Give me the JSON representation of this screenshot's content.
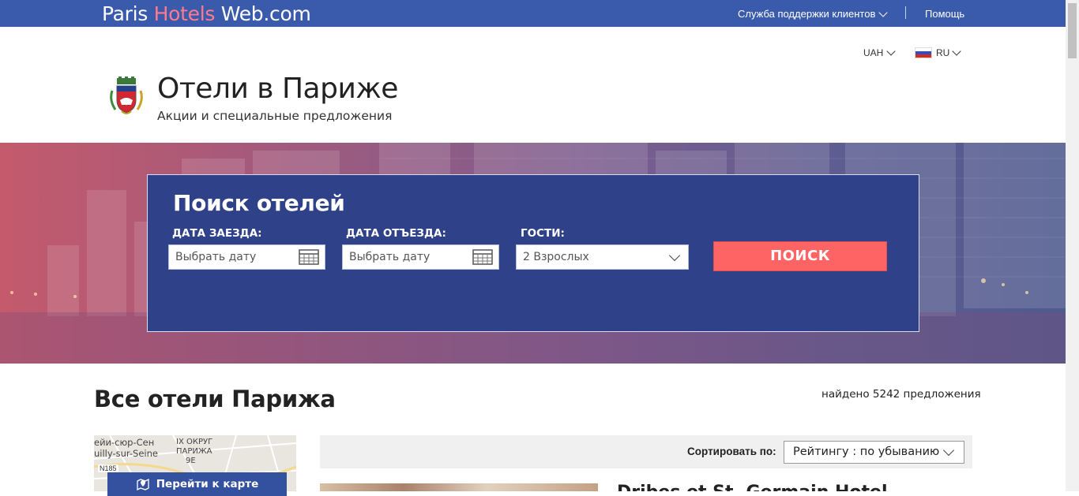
{
  "header": {
    "brand_part1": "Paris ",
    "brand_part2": "Hotels",
    "brand_part3": " Web.com",
    "support_label": "Служба поддержки клиентов",
    "help_label": "Помощь"
  },
  "locale": {
    "currency": "UAH",
    "language": "RU"
  },
  "intro": {
    "title": "Отели в Париже",
    "subtitle": "Акции и специальные предложения"
  },
  "search": {
    "title": "Поиск отелей",
    "checkin_label": "ДАТА ЗАЕЗДА:",
    "checkin_placeholder": "Выбрать дату",
    "checkout_label": "ДАТА ОТЪЕЗДА:",
    "checkout_placeholder": "Выбрать дату",
    "guests_label": "ГОСТИ:",
    "guests_value": "2 Взрослых",
    "submit_label": "ПОИСК"
  },
  "results": {
    "heading": "Все отели Парижа",
    "found_text": "найдено 5242 предложения",
    "sort_label": "Сортировать по:",
    "sort_value": "Рейтингу : по убыванию",
    "first_hotel_title": "Dribes et St. Germain Hotel"
  },
  "map": {
    "label_1": "ейи-сюр-Сен",
    "label_2": "uilly-sur-Seine",
    "label_3": "IX ОКРУГ",
    "label_4": "ПАРИЖА",
    "label_5": "9Е",
    "road_label": "N185",
    "button_label": "Перейти к карте"
  },
  "colors": {
    "topbar": "#3a5aab",
    "brand_accent": "#ff7a8c",
    "search_panel": "#2f4289",
    "search_button": "#ff6464"
  }
}
